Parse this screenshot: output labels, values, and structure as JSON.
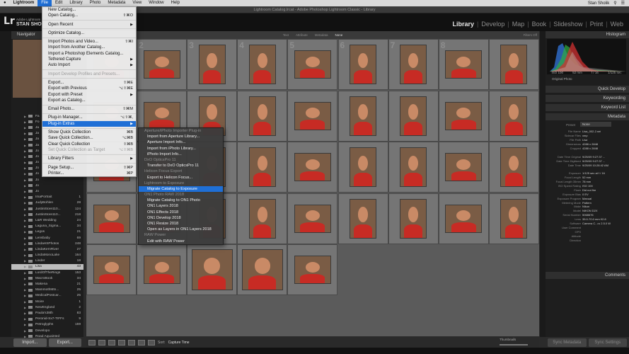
{
  "menubar": {
    "apple": "",
    "items": [
      "Lightroom",
      "File",
      "Edit",
      "Library",
      "Photo",
      "Metadata",
      "View",
      "Window",
      "Help"
    ],
    "active": "File",
    "user": "Stan Sholik",
    "battery": "100%"
  },
  "window_title": "Lightroom Catalog.lrcat - Adobe Photoshop Lightroom Classic - Library",
  "identity": {
    "logo": "Lr",
    "line1": "Adobe Lightroom",
    "line2": "STAN SHO"
  },
  "modules": [
    "Library",
    "Develop",
    "Map",
    "Book",
    "Slideshow",
    "Print",
    "Web"
  ],
  "current_module": "Library",
  "left_panel": {
    "navigator": "Navigator",
    "folders": [
      {
        "name": "Fa",
        "count": ""
      },
      {
        "name": "Fo",
        "count": ""
      },
      {
        "name": "Ja",
        "count": ""
      },
      {
        "name": "Ja",
        "count": ""
      },
      {
        "name": "Ja",
        "count": ""
      },
      {
        "name": "Ja",
        "count": ""
      },
      {
        "name": "Jo",
        "count": ""
      },
      {
        "name": "Jo",
        "count": ""
      },
      {
        "name": "Jo",
        "count": ""
      },
      {
        "name": "Jo",
        "count": ""
      },
      {
        "name": "Jo",
        "count": ""
      },
      {
        "name": "Jo",
        "count": ""
      },
      {
        "name": "Jo",
        "count": ""
      },
      {
        "name": "Jo",
        "count": ""
      },
      {
        "name": "ImaPortrait",
        "count": "1"
      },
      {
        "name": "JudyBohlen",
        "count": "28"
      },
      {
        "name": "JustinStore110...",
        "count": "124"
      },
      {
        "name": "JustinStore110...",
        "count": "218"
      },
      {
        "name": "L&R Wedding",
        "count": "24"
      },
      {
        "name": "Laguna_Sigma...",
        "count": "34"
      },
      {
        "name": "Legos",
        "count": "21"
      },
      {
        "name": "Lensbaby",
        "count": "69"
      },
      {
        "name": "LindaHSPhotos",
        "count": "248"
      },
      {
        "name": "LindaKernRiver",
        "count": "27"
      },
      {
        "name": "LindaMonoLake",
        "count": "164"
      },
      {
        "name": "Linder",
        "count": "18"
      },
      {
        "name": "Lisa",
        "count": "43"
      },
      {
        "name": "LordOfTheRings",
        "count": "153"
      },
      {
        "name": "MacroBook",
        "count": "34"
      },
      {
        "name": "Makena",
        "count": "21"
      },
      {
        "name": "MammothMtn...",
        "count": "25"
      },
      {
        "name": "MedicalPostcar...",
        "count": "25"
      },
      {
        "name": "Moire",
        "count": "1"
      },
      {
        "name": "NewEngland",
        "count": "2"
      },
      {
        "name": "Paula's38th",
        "count": "83"
      },
      {
        "name": "Peronid-Sx7-TIFFs",
        "count": "9"
      },
      {
        "name": "Petroglyphs",
        "count": "159"
      },
      {
        "name": "Developo",
        "count": ""
      },
      {
        "name": "Road Aquainted",
        "count": ""
      }
    ],
    "selected_folder": "Lisa",
    "import_button": "Import...",
    "export_button": "Export..."
  },
  "filter_bar": {
    "items": [
      "Text",
      "Attribute",
      "Metadata",
      "None"
    ],
    "active": "None",
    "filters_off": "Filters Off"
  },
  "grid": {
    "numbers": [
      "",
      "2",
      "3",
      "4",
      "5",
      "6",
      "7",
      "8",
      "",
      "",
      "",
      "",
      "",
      "",
      "",
      "",
      "",
      "",
      "",
      "",
      "",
      "",
      "",
      "",
      "",
      "",
      "",
      "",
      "",
      "",
      "",
      "",
      "",
      "",
      "",
      "",
      "",
      "",
      "",
      "",
      "",
      "",
      ""
    ],
    "cell_count": 41
  },
  "right_panel": {
    "histogram": "Histogram",
    "histo_info": [
      "ISO 100",
      "52 mm",
      "f / 16",
      "1/125 sec"
    ],
    "original_photo": "Original Photo",
    "sections": [
      "Quick Develop",
      "Keywording",
      "Keyword List",
      "Metadata",
      "Comments"
    ],
    "preset_label": "Preset",
    "preset_value": "None",
    "custom_label": "Custom",
    "exif_label": "EXIF",
    "metadata": [
      {
        "k": "File Name",
        "v": "Lisa_002-2.nef"
      },
      {
        "k": "Sidecar Files",
        "v": "xmp"
      },
      {
        "k": "File Path",
        "v": "Lisa"
      },
      {
        "k": "Dimensions",
        "v": "4288 x 2848"
      },
      {
        "k": "Cropped",
        "v": "4288 x 2848"
      },
      {
        "k": "",
        "v": ""
      },
      {
        "k": "Date Time Original",
        "v": "9/25/09 9:27:37 ..."
      },
      {
        "k": "Date Time Digitized",
        "v": "9/25/09 9:27:37 ..."
      },
      {
        "k": "Date Time",
        "v": "9/25/09 10:28:42 AM"
      },
      {
        "k": "",
        "v": ""
      },
      {
        "k": "Exposure",
        "v": "1/125 sec at f / 16"
      },
      {
        "k": "Focal Length",
        "v": "52 mm"
      },
      {
        "k": "Focal Length 35mm",
        "v": "78 mm"
      },
      {
        "k": "ISO Speed Rating",
        "v": "ISO 100"
      },
      {
        "k": "Flash",
        "v": "Did not fire"
      },
      {
        "k": "Exposure Bias",
        "v": "0 EV"
      },
      {
        "k": "Exposure Program",
        "v": "Manual"
      },
      {
        "k": "Metering Mode",
        "v": "Pattern"
      },
      {
        "k": "Make",
        "v": "Nikon"
      },
      {
        "k": "Model",
        "v": "NIKON D2X"
      },
      {
        "k": "Serial Number",
        "v": "5068676"
      },
      {
        "k": "Lens",
        "v": "35.0-70.0 mm f/2.8"
      },
      {
        "k": "Software",
        "v": "Camera C...ro 2.5.0 W"
      },
      {
        "k": "User Comment",
        "v": ""
      },
      {
        "k": "GPS",
        "v": ""
      },
      {
        "k": "Altitude",
        "v": ""
      },
      {
        "k": "Direction",
        "v": ""
      }
    ],
    "sync_metadata": "Sync Metadata",
    "sync_settings": "Sync Settings"
  },
  "toolbar": {
    "sort_label": "Sort:",
    "sort_value": "Capture Time",
    "thumbnails": "Thumbnails"
  },
  "file_menu": [
    {
      "label": "New Catalog...",
      "sc": "",
      "arr": false,
      "dis": false,
      "sep": false
    },
    {
      "label": "Open Catalog...",
      "sc": "⇧⌘O",
      "arr": false,
      "dis": false,
      "sep": false
    },
    {
      "label": "",
      "sep": true
    },
    {
      "label": "Open Recent",
      "sc": "",
      "arr": true,
      "dis": false,
      "sep": false
    },
    {
      "label": "",
      "sep": true
    },
    {
      "label": "Optimize Catalog...",
      "sc": "",
      "arr": false,
      "dis": false,
      "sep": false
    },
    {
      "label": "",
      "sep": true
    },
    {
      "label": "Import Photos and Video...",
      "sc": "⇧⌘I",
      "arr": false,
      "dis": false,
      "sep": false
    },
    {
      "label": "Import from Another Catalog...",
      "sc": "",
      "arr": false,
      "dis": false,
      "sep": false
    },
    {
      "label": "Import a Photoshop Elements Catalog...",
      "sc": "",
      "arr": false,
      "dis": false,
      "sep": false
    },
    {
      "label": "Tethered Capture",
      "sc": "",
      "arr": true,
      "dis": false,
      "sep": false
    },
    {
      "label": "Auto Import",
      "sc": "",
      "arr": true,
      "dis": false,
      "sep": false
    },
    {
      "label": "",
      "sep": true
    },
    {
      "label": "Import Develop Profiles and Presets...",
      "sc": "",
      "arr": false,
      "dis": true,
      "sep": false
    },
    {
      "label": "",
      "sep": true
    },
    {
      "label": "Export...",
      "sc": "⇧⌘E",
      "arr": false,
      "dis": false,
      "sep": false
    },
    {
      "label": "Export with Previous",
      "sc": "⌥⇧⌘E",
      "arr": false,
      "dis": false,
      "sep": false
    },
    {
      "label": "Export with Preset",
      "sc": "",
      "arr": true,
      "dis": false,
      "sep": false
    },
    {
      "label": "Export as Catalog...",
      "sc": "",
      "arr": false,
      "dis": false,
      "sep": false
    },
    {
      "label": "",
      "sep": true
    },
    {
      "label": "Email Photo...",
      "sc": "⇧⌘M",
      "arr": false,
      "dis": false,
      "sep": false
    },
    {
      "label": "",
      "sep": true
    },
    {
      "label": "Plug-in Manager...",
      "sc": "⌥⇧⌘,",
      "arr": false,
      "dis": false,
      "sep": false
    },
    {
      "label": "Plug-in Extras",
      "sc": "",
      "arr": true,
      "dis": false,
      "sep": false,
      "hl": true
    },
    {
      "label": "",
      "sep": true
    },
    {
      "label": "Show Quick Collection",
      "sc": "⌘B",
      "arr": false,
      "dis": false,
      "sep": false
    },
    {
      "label": "Save Quick Collection...",
      "sc": "⌥⌘B",
      "arr": false,
      "dis": false,
      "sep": false
    },
    {
      "label": "Clear Quick Collection",
      "sc": "⇧⌘B",
      "arr": false,
      "dis": false,
      "sep": false
    },
    {
      "label": "Set Quick Collection as Target",
      "sc": "⌥⇧⌘B",
      "arr": false,
      "dis": true,
      "sep": false
    },
    {
      "label": "",
      "sep": true
    },
    {
      "label": "Library Filters",
      "sc": "",
      "arr": true,
      "dis": false,
      "sep": false
    },
    {
      "label": "",
      "sep": true
    },
    {
      "label": "Page Setup...",
      "sc": "⇧⌘P",
      "arr": false,
      "dis": false,
      "sep": false
    },
    {
      "label": "Printer...",
      "sc": "⌘P",
      "arr": false,
      "dis": false,
      "sep": false
    }
  ],
  "submenu": [
    {
      "label": "Aperture/iPhoto Importer Plug-in",
      "hdr": true
    },
    {
      "label": "Import from Aperture Library...",
      "hdr": false
    },
    {
      "label": "Aperture Import Info...",
      "hdr": false
    },
    {
      "label": "Import from iPhoto Library...",
      "hdr": false
    },
    {
      "label": "iPhoto Import Info...",
      "hdr": false
    },
    {
      "label": "DxO OpticsPro 11",
      "hdr": true
    },
    {
      "label": "Transfer to DxO OpticsPro 11",
      "hdr": false
    },
    {
      "label": "Helicon Focus Export",
      "hdr": true
    },
    {
      "label": "Export to Helicon Focus...",
      "hdr": false
    },
    {
      "label": "Lightroom to Exposure",
      "hdr": true
    },
    {
      "label": "Migrate Catalog to Exposure",
      "hdr": false,
      "hl": true
    },
    {
      "label": "ON1 Photo RAW 2018",
      "hdr": true
    },
    {
      "label": "Migrate Catalog to ON1 Photo",
      "hdr": false
    },
    {
      "label": "ON1 Layers 2018",
      "hdr": false
    },
    {
      "label": "ON1 Effects 2018",
      "hdr": false
    },
    {
      "label": "ON1 Develop 2018",
      "hdr": false
    },
    {
      "label": "ON1 Resize 2018",
      "hdr": false
    },
    {
      "label": "Open as Layers in ON1 Layers 2018",
      "hdr": false
    },
    {
      "label": "RAW Power",
      "hdr": true
    },
    {
      "label": "Edit with RAW Power",
      "hdr": false
    }
  ]
}
